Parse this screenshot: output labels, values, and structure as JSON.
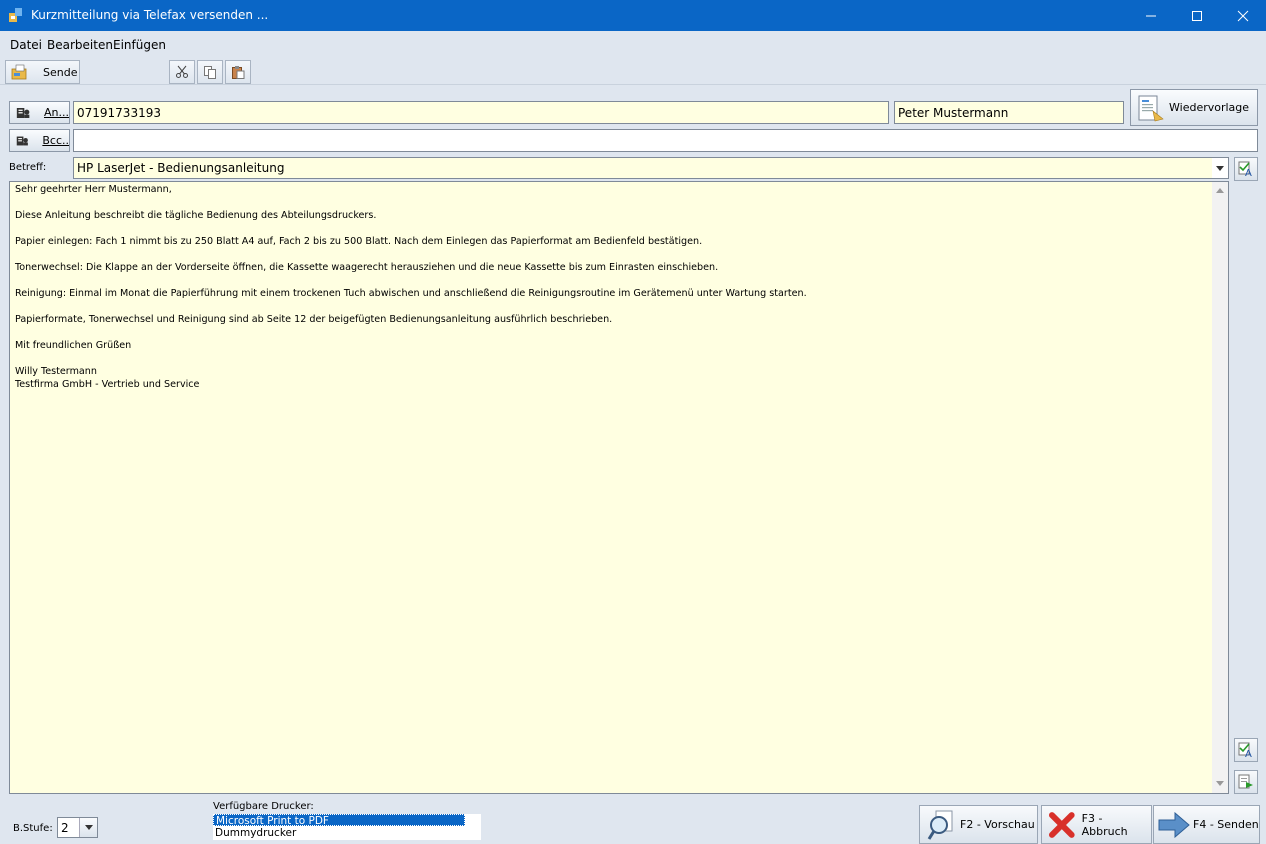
{
  "window": {
    "title": "Kurzmitteilung via Telefax versenden ...",
    "minimize": "—",
    "maximize": "☐",
    "close": "✕"
  },
  "menu": {
    "datei": "Datei",
    "bearbeiten": "Bearbeiten",
    "einfuegen": "Einfügen"
  },
  "toolbar": {
    "send_label": "Sende"
  },
  "recipient": {
    "an_label": "An...",
    "bcc_label": "Bcc..",
    "fax_number": "07191733193",
    "name": "Peter Mustermann",
    "bcc_value": "",
    "wiedervorlage": "Wiedervorlage"
  },
  "subject": {
    "label": "Betreff:",
    "value": "HP LaserJet - Bedienungsanleitung"
  },
  "body": {
    "lines": [
      "Sehr geehrter Herr Mustermann,",
      "Diese Anleitung beschreibt die tägliche Bedienung des Abteilungsdruckers.",
      "Papier einlegen: Fach 1 nimmt bis zu 250 Blatt A4 auf, Fach 2 bis zu 500 Blatt. Nach dem Einlegen das Papierformat am Bedienfeld bestätigen.",
      "Tonerwechsel: Die Klappe an der Vorderseite öffnen, die Kassette waagerecht herausziehen und die neue Kassette bis zum Einrasten einschieben.",
      "Reinigung: Einmal im Monat die Papierführung mit einem trockenen Tuch abwischen und anschließend die Reinigungsroutine im Gerätemenü unter Wartung starten.",
      "Papierformate, Tonerwechsel und Reinigung sind ab Seite 12 der beigefügten Bedienungsanleitung ausführlich beschrieben.",
      "Mit freundlichen Grüßen",
      "Willy Testermann",
      "Testfirma GmbH - Vertrieb und Service"
    ]
  },
  "footer": {
    "bstufe_label": "B.Stufe:",
    "bstufe_value": "2",
    "printers_label": "Verfügbare Drucker:",
    "printers": [
      "Microsoft Print to PDF",
      "Dummydrucker"
    ],
    "preview": "F2 - Vorschau",
    "cancel": "F3 - Abbruch",
    "send": "F4 - Senden"
  },
  "colors": {
    "titlebar": "#0a66c6",
    "field_bg": "#ffffe1",
    "selection": "#0a66c6"
  }
}
